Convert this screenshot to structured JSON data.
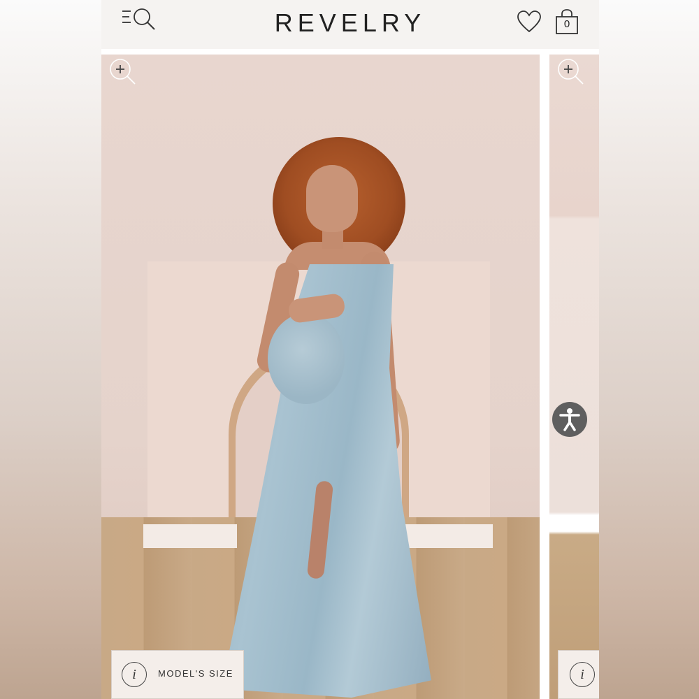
{
  "header": {
    "brand": "REVELRY",
    "menu_search_icon": "menu-search-icon",
    "wishlist_icon": "heart-icon",
    "bag_icon": "shopping-bag-icon",
    "bag_count": "0"
  },
  "gallery": {
    "zoom_icon": "zoom-in-icon",
    "model_size_label": "MODEL'S SIZE",
    "info_glyph": "i",
    "accessibility_icon": "accessibility-icon",
    "product_image": "model in dusty blue maternity chiffon gown"
  },
  "colors": {
    "header_bg": "#f5f3f1",
    "dress": "#a3bccb",
    "backdrop": "#e8d6cf",
    "floor": "#c8a986",
    "accessibility_bg": "#5f5f5f"
  }
}
